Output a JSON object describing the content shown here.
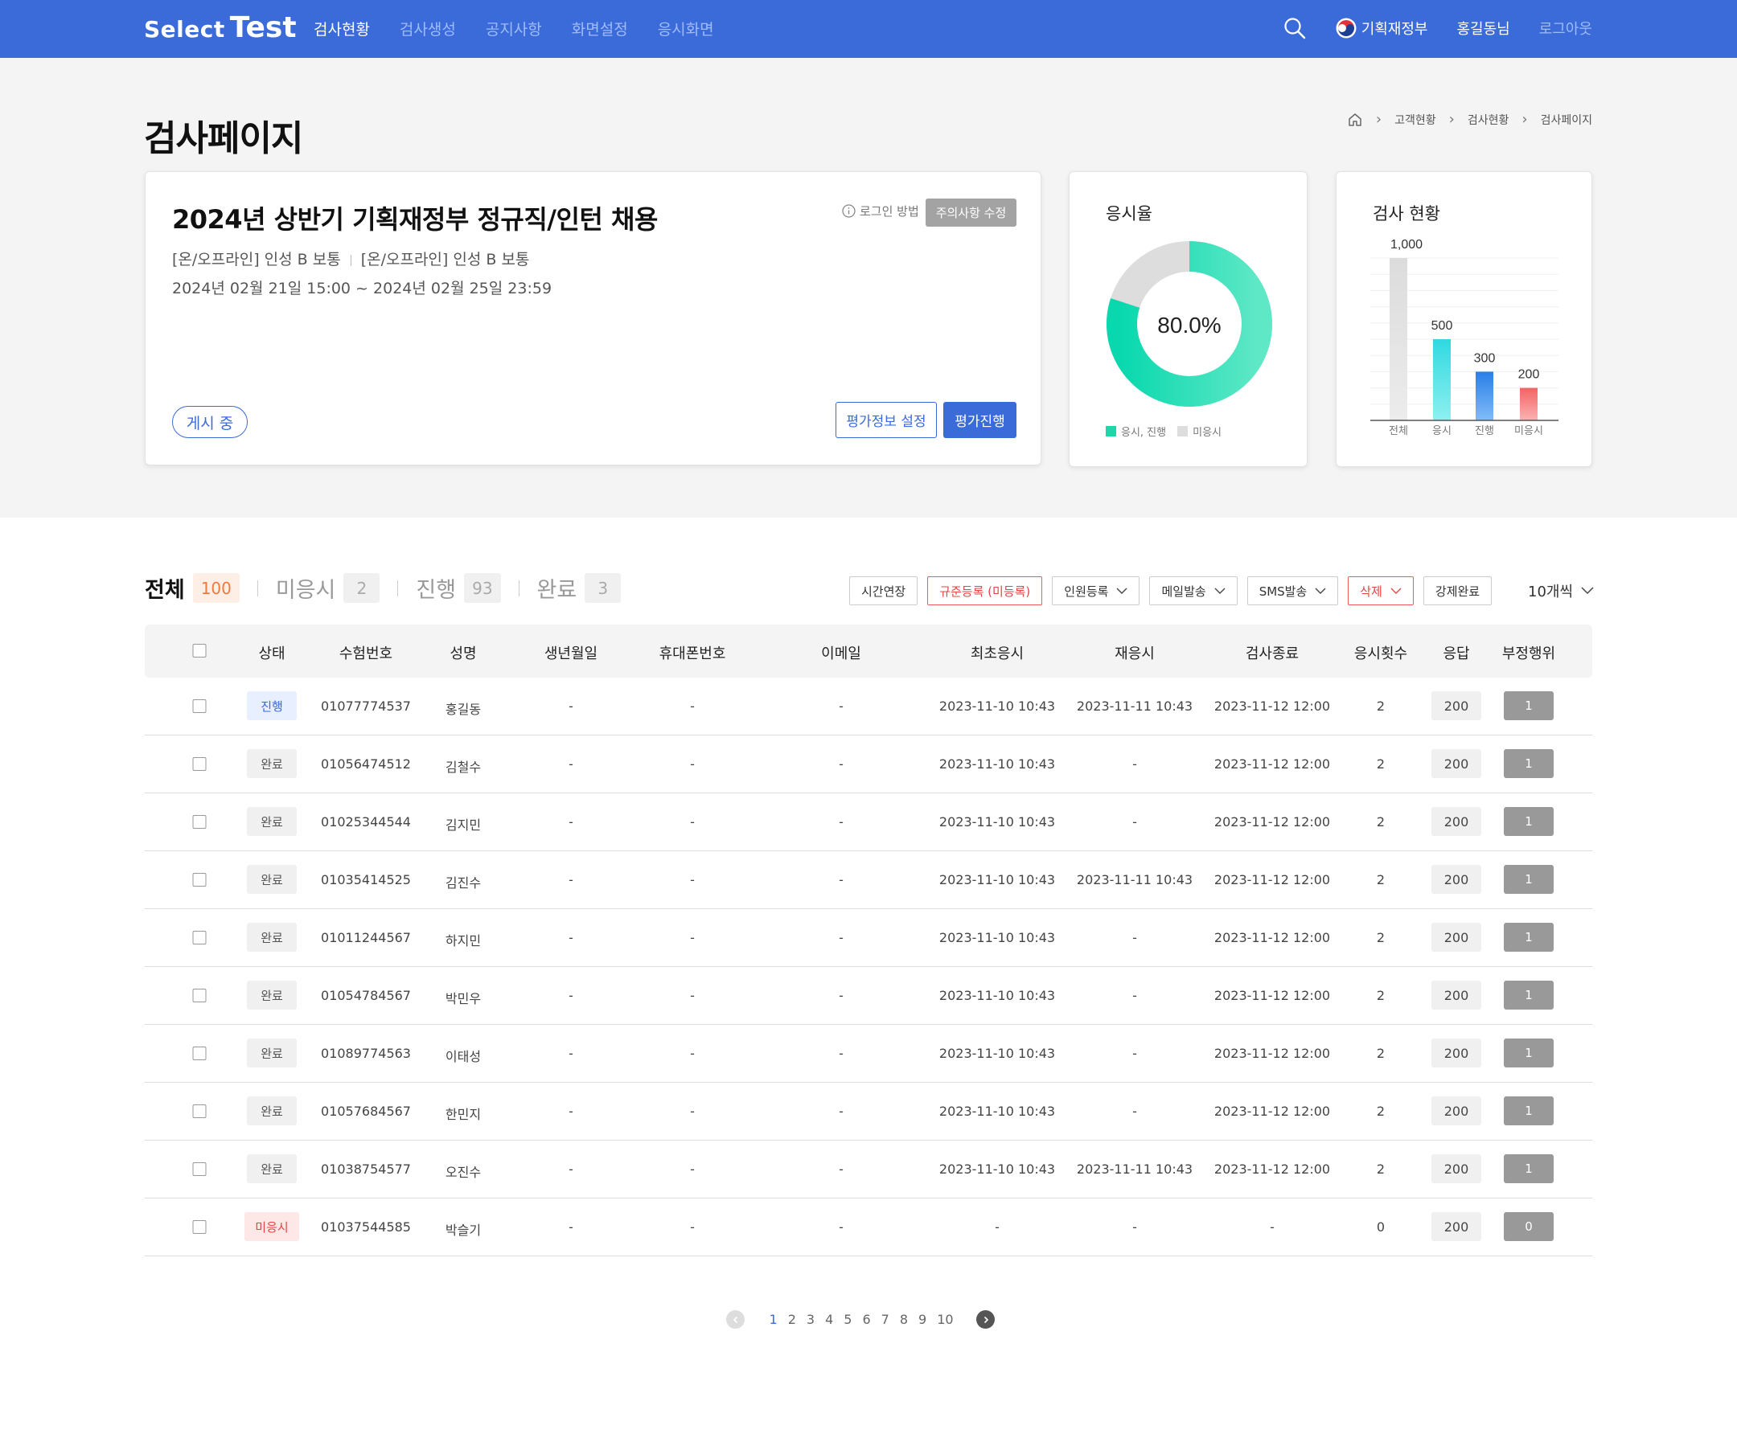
{
  "header": {
    "logo_part1": "Select",
    "logo_part2": "Test",
    "nav": [
      "검사현황",
      "검사생성",
      "공지사항",
      "화면설정",
      "응시화면"
    ],
    "active_nav": 0,
    "org_name": "기획재정부",
    "user_name": "홍길동님",
    "logout_label": "로그아웃",
    "colors": {
      "primary": "#3b6ad9",
      "nav_inactive": "#9fbcff"
    }
  },
  "page": {
    "title": "검사페이지",
    "breadcrumb": [
      "고객현황",
      "검사현황",
      "검사페이지"
    ]
  },
  "exam": {
    "title": "2024년 상반기 기획재정부 정규직/인턴 채용",
    "sub_1": "[온/오프라인] 인성 B 보통",
    "sub_2": "[온/오프라인] 인성 B 보통",
    "period": "2024년 02월 21일 15:00 ~ 2024년 02월 25일 23:59",
    "login_method_label": "로그인 방법",
    "notice_edit_label": "주의사항 수정",
    "status_label": "게시 중",
    "eval_setting_label": "평가정보 설정",
    "eval_progress_label": "평가진행"
  },
  "rate_card": {
    "title": "응시율",
    "rate_text": "80.0%",
    "rate": 0.8,
    "legend": [
      {
        "label": "응시, 진행",
        "color": "#1fd6a8"
      },
      {
        "label": "미응시",
        "color": "#dddddd"
      }
    ]
  },
  "status_card": {
    "title": "검사 현황"
  },
  "chart_data": {
    "type": "bar",
    "categories": [
      "전체",
      "응시",
      "진행",
      "미응시"
    ],
    "values": [
      1000,
      500,
      300,
      200
    ],
    "value_labels": [
      "1,000",
      "500",
      "300",
      "200"
    ],
    "colors": [
      "#dddddd",
      "#37e0d8",
      "#3b8ff0",
      "#f27575"
    ],
    "ylim": [
      0,
      1000
    ],
    "grid": true
  },
  "tabs": [
    {
      "label": "전체",
      "count": "100"
    },
    {
      "label": "미응시",
      "count": "2"
    },
    {
      "label": "진행",
      "count": "93"
    },
    {
      "label": "완료",
      "count": "3"
    }
  ],
  "actions": {
    "time_extend": "시간연장",
    "norm_register": "규준등록 (미등록)",
    "member_register": "인원등록",
    "mail_send": "메일발송",
    "sms_send": "SMS발송",
    "delete": "삭제",
    "force_complete": "강제완료",
    "per_page": "10개씩"
  },
  "table": {
    "headers": [
      "상태",
      "수험번호",
      "성명",
      "생년월일",
      "휴대폰번호",
      "이메일",
      "최초응시",
      "재응시",
      "검사종료",
      "응시횟수",
      "응답",
      "부정행위"
    ],
    "rows": [
      {
        "status": "진행",
        "type": "prog",
        "id": "01077774537",
        "name": "홍길동",
        "birth": "-",
        "phone": "-",
        "email": "-",
        "first": "2023-11-10 10:43",
        "retake": "2023-11-11 10:43",
        "end": "2023-11-12 12:00",
        "count": "2",
        "resp": "200",
        "fraud": "1"
      },
      {
        "status": "완료",
        "type": "done",
        "id": "01056474512",
        "name": "김철수",
        "birth": "-",
        "phone": "-",
        "email": "-",
        "first": "2023-11-10 10:43",
        "retake": "-",
        "end": "2023-11-12 12:00",
        "count": "2",
        "resp": "200",
        "fraud": "1"
      },
      {
        "status": "완료",
        "type": "done",
        "id": "01025344544",
        "name": "김지민",
        "birth": "-",
        "phone": "-",
        "email": "-",
        "first": "2023-11-10 10:43",
        "retake": "-",
        "end": "2023-11-12 12:00",
        "count": "2",
        "resp": "200",
        "fraud": "1"
      },
      {
        "status": "완료",
        "type": "done",
        "id": "01035414525",
        "name": "김진수",
        "birth": "-",
        "phone": "-",
        "email": "-",
        "first": "2023-11-10 10:43",
        "retake": "2023-11-11 10:43",
        "end": "2023-11-12 12:00",
        "count": "2",
        "resp": "200",
        "fraud": "1"
      },
      {
        "status": "완료",
        "type": "done",
        "id": "01011244567",
        "name": "하지민",
        "birth": "-",
        "phone": "-",
        "email": "-",
        "first": "2023-11-10 10:43",
        "retake": "-",
        "end": "2023-11-12 12:00",
        "count": "2",
        "resp": "200",
        "fraud": "1"
      },
      {
        "status": "완료",
        "type": "done",
        "id": "01054784567",
        "name": "박민우",
        "birth": "-",
        "phone": "-",
        "email": "-",
        "first": "2023-11-10 10:43",
        "retake": "-",
        "end": "2023-11-12 12:00",
        "count": "2",
        "resp": "200",
        "fraud": "1"
      },
      {
        "status": "완료",
        "type": "done",
        "id": "01089774563",
        "name": "이태성",
        "birth": "-",
        "phone": "-",
        "email": "-",
        "first": "2023-11-10 10:43",
        "retake": "-",
        "end": "2023-11-12 12:00",
        "count": "2",
        "resp": "200",
        "fraud": "1"
      },
      {
        "status": "완료",
        "type": "done",
        "id": "01057684567",
        "name": "한민지",
        "birth": "-",
        "phone": "-",
        "email": "-",
        "first": "2023-11-10 10:43",
        "retake": "-",
        "end": "2023-11-12 12:00",
        "count": "2",
        "resp": "200",
        "fraud": "1"
      },
      {
        "status": "완료",
        "type": "done",
        "id": "01038754577",
        "name": "오진수",
        "birth": "-",
        "phone": "-",
        "email": "-",
        "first": "2023-11-10 10:43",
        "retake": "2023-11-11 10:43",
        "end": "2023-11-12 12:00",
        "count": "2",
        "resp": "200",
        "fraud": "1"
      },
      {
        "status": "미응시",
        "type": "none",
        "id": "01037544585",
        "name": "박슬기",
        "birth": "-",
        "phone": "-",
        "email": "-",
        "first": "-",
        "retake": "-",
        "end": "-",
        "count": "0",
        "resp": "200",
        "fraud": "0"
      }
    ]
  },
  "pagination": {
    "pages": [
      "1",
      "2",
      "3",
      "4",
      "5",
      "6",
      "7",
      "8",
      "9",
      "10"
    ],
    "current": "1"
  }
}
